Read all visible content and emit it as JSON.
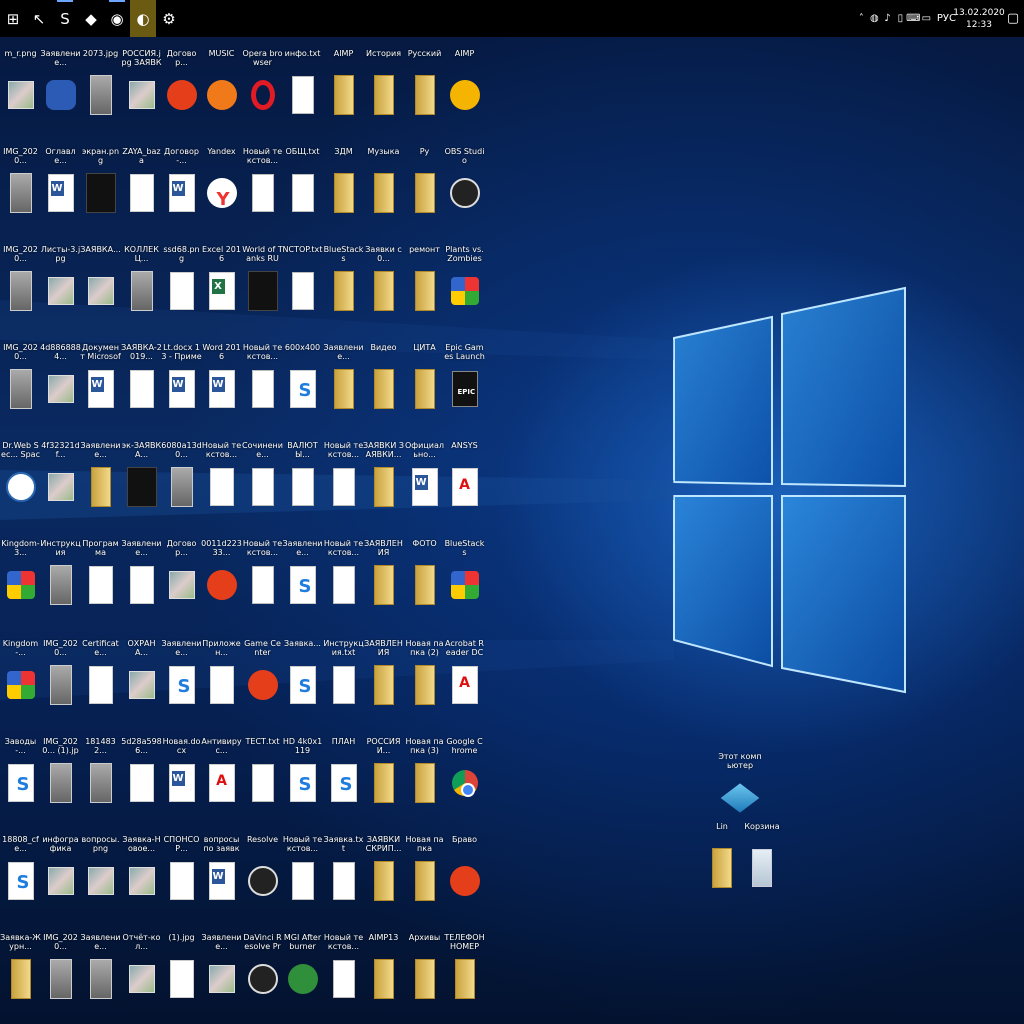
{
  "taskbar": {
    "pinned": [
      {
        "name": "start-button",
        "icon": "windows-logo-icon",
        "glyph": "⊞",
        "state": ""
      },
      {
        "name": "taskbar-pin-1",
        "icon": "cursor-icon",
        "glyph": "↖",
        "state": ""
      },
      {
        "name": "taskbar-pin-2",
        "icon": "skype-icon",
        "glyph": "S",
        "state": "running"
      },
      {
        "name": "taskbar-pin-3",
        "icon": "bluestacks-icon",
        "glyph": "◆",
        "state": ""
      },
      {
        "name": "taskbar-pin-4",
        "icon": "browser-icon",
        "glyph": "◉",
        "state": "running"
      },
      {
        "name": "taskbar-pin-5",
        "icon": "edge-icon",
        "glyph": "◐",
        "state": "active"
      },
      {
        "name": "taskbar-pin-6",
        "icon": "settings-icon",
        "glyph": "⚙",
        "state": ""
      }
    ],
    "tray": {
      "icons": [
        "chevron-up-icon",
        "network-icon",
        "volume-icon",
        "battery-icon",
        "keyboard-icon",
        "display-icon"
      ],
      "glyphs": [
        "˄",
        "◍",
        "♪",
        "▯",
        "⌨",
        "▭"
      ],
      "language": "РУС",
      "time": "12:33",
      "date": "13.02.2020",
      "notification_glyph": "▢"
    }
  },
  "desktop": {
    "columns": [
      [
        {
          "label": "m_r.png",
          "type": "image"
        },
        {
          "label": "IMG_2020...",
          "type": "photo"
        },
        {
          "label": "IMG_2020...",
          "type": "photo"
        },
        {
          "label": "IMG_2020...",
          "type": "photo"
        },
        {
          "label": "Dr.Web Sec... Space",
          "type": "round"
        },
        {
          "label": "Kingdom-3...",
          "type": "multi"
        },
        {
          "label": "Kingdom-...",
          "type": "multi"
        },
        {
          "label": "Заводы-...",
          "type": "lnk"
        },
        {
          "label": "18808_cfe...",
          "type": "lnk"
        },
        {
          "label": "Заявка-Журн...",
          "type": "folder"
        }
      ],
      [
        {
          "label": "Заявление...",
          "type": "app-gear"
        },
        {
          "label": "Оглавле...",
          "type": "word"
        },
        {
          "label": "Листы-3.jpg",
          "type": "image"
        },
        {
          "label": "4d8868884...",
          "type": "image"
        },
        {
          "label": "4f32321df...",
          "type": "image"
        },
        {
          "label": "Инструкция",
          "type": "photo"
        },
        {
          "label": "IMG_2020...",
          "type": "photo"
        },
        {
          "label": "IMG_2020... (1).jpg",
          "type": "photo"
        },
        {
          "label": "инфографика",
          "type": "image"
        },
        {
          "label": "IMG_2020...",
          "type": "photo"
        }
      ],
      [
        {
          "label": "2073.jpg",
          "type": "photo"
        },
        {
          "label": "экран.png",
          "type": "dark"
        },
        {
          "label": "ЗАЯВКА...",
          "type": "image"
        },
        {
          "label": "Документ Microsoft...",
          "type": "word"
        },
        {
          "label": "Заявление...",
          "type": "folder"
        },
        {
          "label": "Программа",
          "type": "doc"
        },
        {
          "label": "Certificate...",
          "type": "doc"
        },
        {
          "label": "1814832...",
          "type": "photo"
        },
        {
          "label": "вопросы.png",
          "type": "image"
        },
        {
          "label": "Заявление...",
          "type": "photo"
        }
      ],
      [
        {
          "label": "РОССИЯ.jpg ЗАЯВКА",
          "type": "image"
        },
        {
          "label": "ZAYA_baza",
          "type": "doc"
        },
        {
          "label": "КОЛЛЕКЦ...",
          "type": "photo"
        },
        {
          "label": "ЗАЯВКА-2019...",
          "type": "doc"
        },
        {
          "label": "эк-ЗАЯВКА...",
          "type": "dark"
        },
        {
          "label": "Заявление...",
          "type": "doc"
        },
        {
          "label": "ОХРАНА...",
          "type": "image"
        },
        {
          "label": "5d28a5986...",
          "type": "doc"
        },
        {
          "label": "Заявка-Новое...",
          "type": "image"
        },
        {
          "label": "Отчёт-кол...",
          "type": "image"
        }
      ],
      [
        {
          "label": "Договор...",
          "type": "app-red"
        },
        {
          "label": "Договор-...",
          "type": "word"
        },
        {
          "label": "ssd68.png",
          "type": "doc"
        },
        {
          "label": "Lt.docx 13 - Пример",
          "type": "word"
        },
        {
          "label": "6080a13d0...",
          "type": "photo"
        },
        {
          "label": "Договор...",
          "type": "image"
        },
        {
          "label": "Заявление...",
          "type": "lnk"
        },
        {
          "label": "Новая.docx",
          "type": "word"
        },
        {
          "label": "СПОНСОР...",
          "type": "doc"
        },
        {
          "label": "(1).jpg",
          "type": "doc"
        }
      ],
      [
        {
          "label": "MUSIC",
          "type": "app-orange"
        },
        {
          "label": "Yandex",
          "type": "yandex"
        },
        {
          "label": "Excel 2016",
          "type": "excel"
        },
        {
          "label": "Word 2016",
          "type": "word"
        },
        {
          "label": "Новый текстов...",
          "type": "doc"
        },
        {
          "label": "0011d22333...",
          "type": "app-red"
        },
        {
          "label": "Приложен...",
          "type": "doc"
        },
        {
          "label": "Антивирус...",
          "type": "pdf"
        },
        {
          "label": "вопросы по заявкам...",
          "type": "word"
        },
        {
          "label": "Заявление...",
          "type": "image"
        }
      ],
      [
        {
          "label": "Opera browser",
          "type": "opera"
        },
        {
          "label": "Новый текстов...",
          "type": "txt"
        },
        {
          "label": "World of Tanks RU",
          "type": "dark"
        },
        {
          "label": "Новый текстов...",
          "type": "txt"
        },
        {
          "label": "Сочинение...",
          "type": "txt"
        },
        {
          "label": "Новый текстов...",
          "type": "txt"
        },
        {
          "label": "Game Center",
          "type": "app-red"
        },
        {
          "label": "ТЕСТ.txt",
          "type": "txt"
        },
        {
          "label": "Resolve",
          "type": "obs"
        },
        {
          "label": "DaVinci Resolve Pro...",
          "type": "obs"
        }
      ],
      [
        {
          "label": "инфо.txt",
          "type": "txt"
        },
        {
          "label": "ОБЩ.txt",
          "type": "txt"
        },
        {
          "label": "NCTOP.txt",
          "type": "txt"
        },
        {
          "label": "600x400",
          "type": "lnk"
        },
        {
          "label": "ВАЛЮТЫ...",
          "type": "txt"
        },
        {
          "label": "Заявление...",
          "type": "lnk"
        },
        {
          "label": "Заявка...",
          "type": "lnk"
        },
        {
          "label": "HD 4k0x1119",
          "type": "lnk"
        },
        {
          "label": "Новый текстов...",
          "type": "txt"
        },
        {
          "label": "MGI Afterburner",
          "type": "app-green"
        }
      ],
      [
        {
          "label": "AIMP",
          "type": "folder"
        },
        {
          "label": "ЗДМ",
          "type": "folder"
        },
        {
          "label": "BlueStacks",
          "type": "folder"
        },
        {
          "label": "Заявление...",
          "type": "folder"
        },
        {
          "label": "Новый текстов...",
          "type": "txt"
        },
        {
          "label": "Новый текстов...",
          "type": "txt"
        },
        {
          "label": "Инструкция.txt",
          "type": "txt"
        },
        {
          "label": "ПЛАН",
          "type": "lnk"
        },
        {
          "label": "Заявка.txt",
          "type": "txt"
        },
        {
          "label": "Новый текстов...",
          "type": "txt"
        }
      ],
      [
        {
          "label": "История",
          "type": "folder"
        },
        {
          "label": "Музыка",
          "type": "folder"
        },
        {
          "label": "Заявки с 0...",
          "type": "folder"
        },
        {
          "label": "Видео",
          "type": "folder"
        },
        {
          "label": "ЗАЯВКИ ЗАЯВКИ...",
          "type": "folder"
        },
        {
          "label": "ЗАЯВЛЕНИЯ",
          "type": "folder"
        },
        {
          "label": "ЗАЯВЛЕНИЯ",
          "type": "folder"
        },
        {
          "label": "РОССИЯ И...",
          "type": "folder"
        },
        {
          "label": "ЗАЯВКИ СКРИП...",
          "type": "folder"
        },
        {
          "label": "AIMP13",
          "type": "folder"
        }
      ],
      [
        {
          "label": "Русский",
          "type": "folder"
        },
        {
          "label": "Ру",
          "type": "folder"
        },
        {
          "label": "ремонт",
          "type": "folder"
        },
        {
          "label": "ЦИТА",
          "type": "folder"
        },
        {
          "label": "Официально...",
          "type": "word"
        },
        {
          "label": "ФОТО",
          "type": "folder"
        },
        {
          "label": "Новая папка (2)",
          "type": "folder"
        },
        {
          "label": "Новая папка (3)",
          "type": "folder"
        },
        {
          "label": "Новая папка",
          "type": "folder"
        },
        {
          "label": "Архивы",
          "type": "folder"
        }
      ],
      [
        {
          "label": "AIMP",
          "type": "aimp"
        },
        {
          "label": "OBS Studio",
          "type": "obs"
        },
        {
          "label": "Plants vs. Zombies",
          "type": "multi"
        },
        {
          "label": "Epic Games Launcher",
          "type": "epic"
        },
        {
          "label": "ANSYS",
          "type": "pdf"
        },
        {
          "label": "BlueStacks",
          "type": "multi"
        },
        {
          "label": "Acrobat Reader DC",
          "type": "pdf"
        },
        {
          "label": "Google Chrome",
          "type": "chrome"
        },
        {
          "label": "Браво",
          "type": "app-red"
        },
        {
          "label": "ТЕЛЕФОН НОМЕР",
          "type": "folder"
        }
      ]
    ],
    "right_icons": [
      {
        "label": "Этот компьютер",
        "type": "cube"
      },
      {
        "label": "Lin",
        "type": "folder"
      },
      {
        "label": "Корзина",
        "type": "recycle"
      }
    ]
  }
}
